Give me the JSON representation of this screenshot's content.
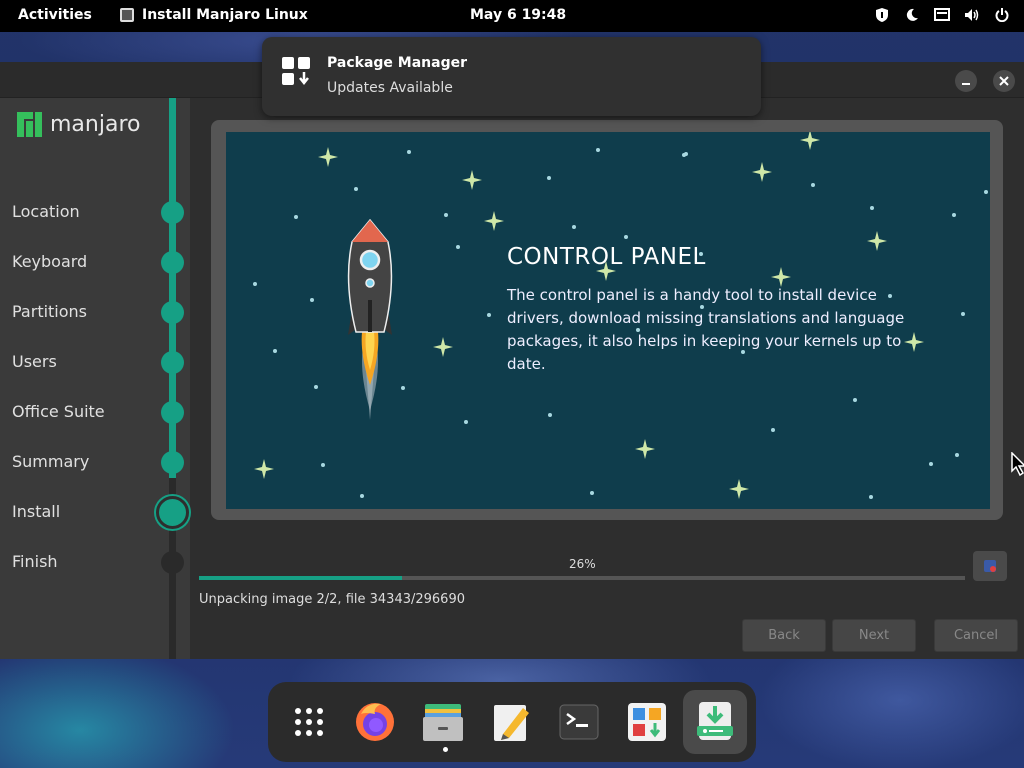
{
  "topbar": {
    "activities": "Activities",
    "app_title": "Install Manjaro Linux",
    "clock": "May 6  19:48"
  },
  "notification": {
    "title": "Package Manager",
    "body": "Updates Available"
  },
  "sidebar": {
    "logo_text": "manjaro",
    "steps": [
      {
        "label": "Location",
        "state": "done"
      },
      {
        "label": "Keyboard",
        "state": "done"
      },
      {
        "label": "Partitions",
        "state": "done"
      },
      {
        "label": "Users",
        "state": "done"
      },
      {
        "label": "Office Suite",
        "state": "done"
      },
      {
        "label": "Summary",
        "state": "done"
      },
      {
        "label": "Install",
        "state": "current"
      },
      {
        "label": "Finish",
        "state": "pending"
      }
    ]
  },
  "slide": {
    "title": "CONTROL PANEL",
    "body": "The control panel is a handy tool to install device drivers, download missing translations and language packages, it also helps in keeping your kernels up to date."
  },
  "progress": {
    "percent_label": "26%",
    "fraction": 0.26,
    "status": "Unpacking image 2/2, file 34343/296690"
  },
  "buttons": {
    "back": "Back",
    "next": "Next",
    "cancel": "Cancel"
  },
  "colors": {
    "accent": "#16a085",
    "slide_bg": "#0f3d4c",
    "manjaro_green": "#35bf5c"
  },
  "dock": {
    "items": [
      "app-grid-icon",
      "firefox-icon",
      "files-icon",
      "text-editor-icon",
      "terminal-icon",
      "software-store-icon",
      "installer-icon"
    ]
  }
}
